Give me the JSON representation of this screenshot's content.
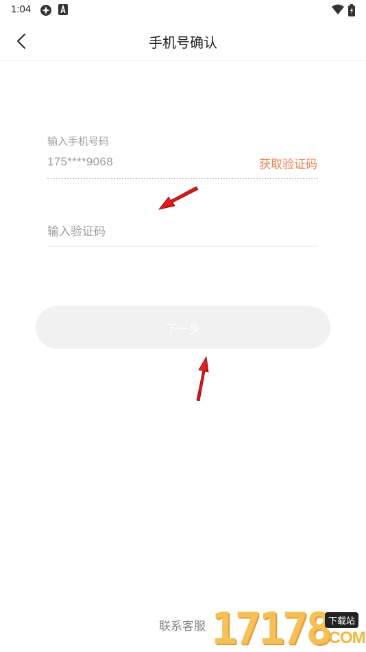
{
  "status_bar": {
    "time": "1:04"
  },
  "header": {
    "title": "手机号确认",
    "back_icon": "chevron-left-icon"
  },
  "form": {
    "phone_label": "输入手机号码",
    "phone_value": "175****9068",
    "get_code_label": "获取验证码",
    "code_placeholder": "输入验证码",
    "next_label": "下一步"
  },
  "footer": {
    "customer_service": "联系客服"
  },
  "watermark": {
    "digits": "17178",
    "tag": "下载站",
    "domain": ".COM"
  },
  "colors": {
    "accent": "#f0825a",
    "button_bg": "#f1f1f1",
    "annotation_arrow": "#e02020"
  }
}
